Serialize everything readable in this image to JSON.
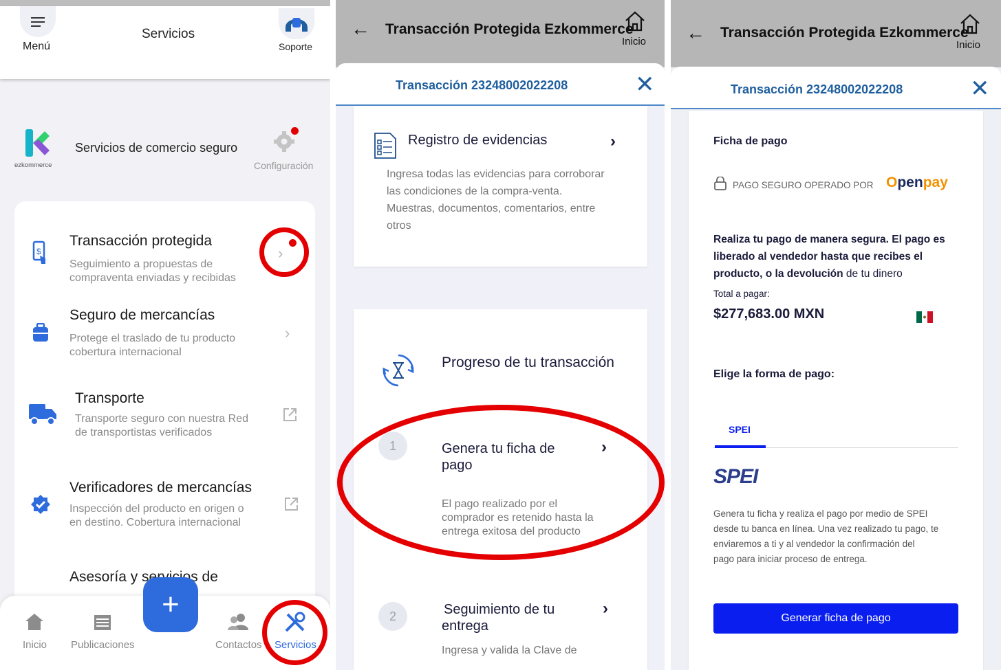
{
  "panel1": {
    "header": {
      "menu_label": "Menú",
      "title": "Servicios",
      "support_label": "Soporte"
    },
    "brand": {
      "logo_text": "ezkommerce",
      "title": "Servicios de comercio seguro",
      "config_label": "Configuración"
    },
    "services": [
      {
        "title": "Transacción protegida",
        "desc1": "Seguimiento a propuestas de",
        "desc2": "compraventa enviadas y recibidas"
      },
      {
        "title": "Seguro de mercancías",
        "desc1": "Protege el traslado de tu producto",
        "desc2": "cobertura internacional"
      },
      {
        "title": "Transporte",
        "desc1": "Transporte seguro con nuestra Red",
        "desc2": "de transportistas verificados"
      },
      {
        "title": "Verificadores de mercancías",
        "desc1": "Inspección del producto en origen o",
        "desc2": "en destino. Cobertura internacional"
      },
      {
        "title": "Asesoría y servicios de"
      }
    ],
    "nav": {
      "inicio": "Inicio",
      "publicaciones": "Publicaciones",
      "fab": "+",
      "contactos": "Contactos",
      "servicios": "Servicios"
    },
    "colors": {
      "accent": "#2e6bdc",
      "highlight": "#e40000"
    }
  },
  "panel2": {
    "header_title": "Transacción Protegida Ezkommerce",
    "home_label": "Inicio",
    "txn_title": "Transacción 23248002022208",
    "evidence": {
      "title": "Registro de evidencias",
      "lines": [
        "Ingresa todas las evidencias para corroborar",
        "las condiciones de la compra-venta.",
        "Muestras, documentos, comentarios, entre",
        "otros"
      ]
    },
    "progress_title": "Progreso de tu transacción",
    "steps": [
      {
        "num": "1",
        "title1": "Genera tu ficha de",
        "title2": "pago",
        "desc": [
          "El pago realizado por el",
          "comprador es retenido hasta la",
          "entrega exitosa del producto"
        ]
      },
      {
        "num": "2",
        "title1": "Seguimiento de tu",
        "title2": "entrega",
        "desc": [
          "Ingresa y valida la Clave de"
        ]
      }
    ]
  },
  "panel3": {
    "header_title": "Transacción Protegida Ezkommerce",
    "home_label": "Inicio",
    "txn_title": "Transacción 23248002022208",
    "ficha_title": "Ficha de pago",
    "secure_label": "PAGO SEGURO OPERADO POR",
    "openpay": {
      "o": "O",
      "pen": "pen",
      "pay": "pay"
    },
    "info": {
      "line1": "Realiza tu pago de manera segura. El pago es",
      "line2": "liberado al vendedor hasta que recibes el",
      "line3_bold": "producto, o la devolución",
      "line3_rest": " de tu dinero"
    },
    "total_label": "Total a pagar:",
    "total_value": "$277,683.00 MXN",
    "choose_label": "Elige la forma de pago:",
    "tab_spei": "SPEI",
    "spei_logo": "SPEI",
    "spei_desc": [
      "Genera tu ficha y realiza el pago por medio de SPEI",
      "desde tu banca en línea. Una vez realizado tu pago, te",
      "enviaremos a ti y al vendedor la confirmación del",
      "pago para iniciar proceso de entrega."
    ],
    "button_label": "Generar ficha de pago",
    "colors": {
      "button": "#0a1ef0",
      "title_blue": "#1f5f9e"
    }
  }
}
